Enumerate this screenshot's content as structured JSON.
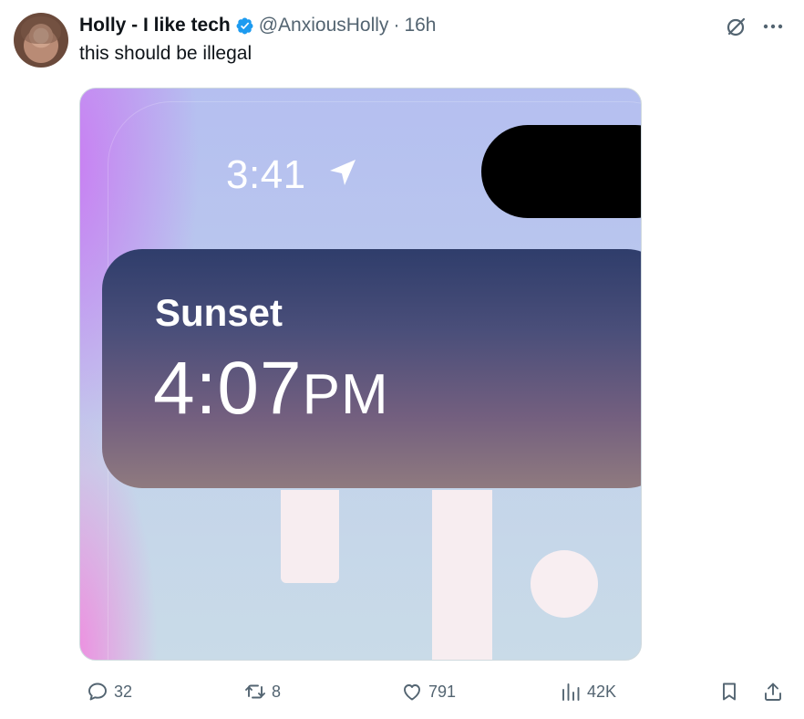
{
  "tweet": {
    "author_name": "Holly - I like tech",
    "handle": "@AnxiousHolly",
    "separator": "·",
    "time": "16h",
    "text": "this should be illegal",
    "verified": true
  },
  "media": {
    "status_time": "3:41",
    "widget_label": "Sunset",
    "widget_time": "4:07",
    "widget_ampm": "PM"
  },
  "actions": {
    "replies": "32",
    "retweets": "8",
    "likes": "791",
    "views": "42K"
  },
  "icons": {
    "verified": "verified-badge-icon",
    "grok": "grok-icon",
    "more": "more-icon",
    "reply": "reply-icon",
    "retweet": "retweet-icon",
    "like": "heart-icon",
    "views": "views-icon",
    "bookmark": "bookmark-icon",
    "share": "share-icon"
  },
  "colors": {
    "verified_blue": "#1d9bf0",
    "secondary_text": "#536471",
    "primary_text": "#0f1419"
  }
}
